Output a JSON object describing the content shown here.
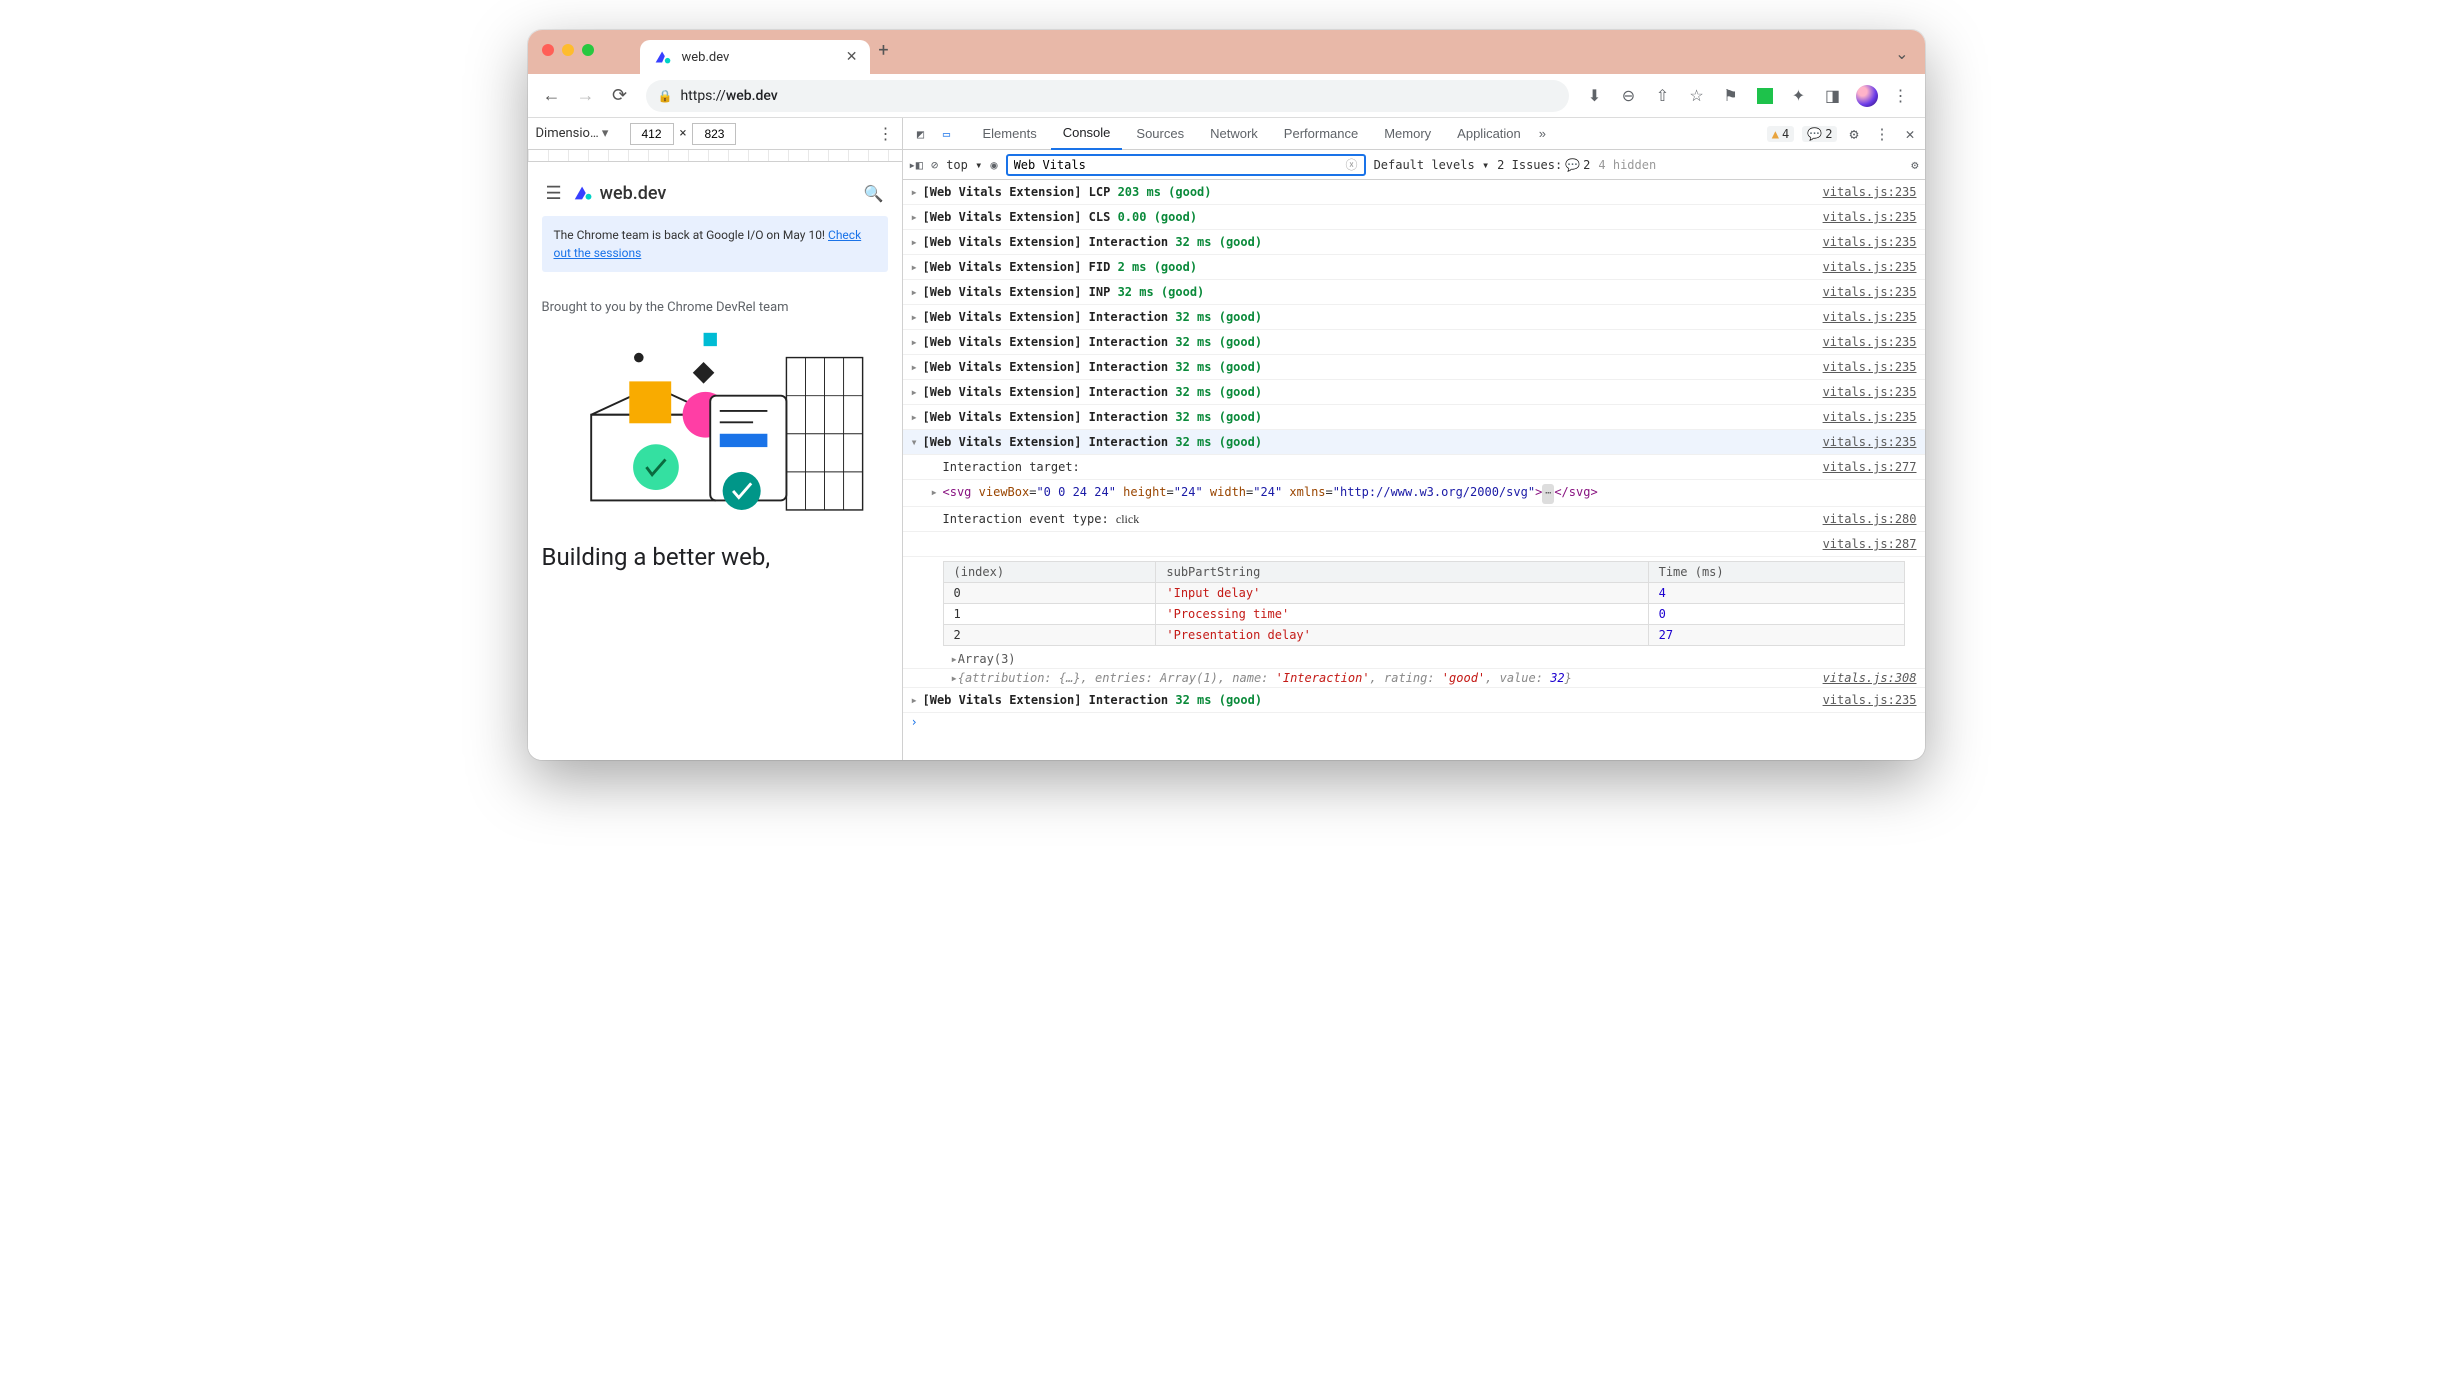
{
  "browser": {
    "tab_title": "web.dev",
    "url_display": "https://web.dev",
    "url_host": "web.dev",
    "traffic": [
      "red",
      "yellow",
      "green"
    ]
  },
  "device": {
    "dimensions_label": "Dimensio…",
    "width": "412",
    "height": "823",
    "times": "×"
  },
  "preview": {
    "brand": "web.dev",
    "banner_text_pre": "The Chrome team is back at Google I/O on May 10! ",
    "banner_link": "Check out the sessions",
    "brought": "Brought to you by the Chrome DevRel team",
    "headline": "Building a better web,"
  },
  "devtools": {
    "tabs": [
      "Elements",
      "Console",
      "Sources",
      "Network",
      "Performance",
      "Memory",
      "Application"
    ],
    "active_tab": "Console",
    "more": "»",
    "warn_count": "4",
    "msg_count": "2",
    "filter_top": "top",
    "filter_value": "Web Vitals",
    "levels": "Default levels",
    "issues_label": "2 Issues:",
    "issues_count": "2",
    "hidden": "4 hidden"
  },
  "console_rows": [
    {
      "prefix": "[Web Vitals Extension]",
      "metric": "LCP",
      "val": "203 ms (good)",
      "src": "vitals.js:235"
    },
    {
      "prefix": "[Web Vitals Extension]",
      "metric": "CLS",
      "val": "0.00 (good)",
      "src": "vitals.js:235"
    },
    {
      "prefix": "[Web Vitals Extension]",
      "metric": "Interaction",
      "val": "32 ms (good)",
      "src": "vitals.js:235"
    },
    {
      "prefix": "[Web Vitals Extension]",
      "metric": "FID",
      "val": "2 ms (good)",
      "src": "vitals.js:235"
    },
    {
      "prefix": "[Web Vitals Extension]",
      "metric": "INP",
      "val": "32 ms (good)",
      "src": "vitals.js:235"
    },
    {
      "prefix": "[Web Vitals Extension]",
      "metric": "Interaction",
      "val": "32 ms (good)",
      "src": "vitals.js:235"
    },
    {
      "prefix": "[Web Vitals Extension]",
      "metric": "Interaction",
      "val": "32 ms (good)",
      "src": "vitals.js:235"
    },
    {
      "prefix": "[Web Vitals Extension]",
      "metric": "Interaction",
      "val": "32 ms (good)",
      "src": "vitals.js:235"
    },
    {
      "prefix": "[Web Vitals Extension]",
      "metric": "Interaction",
      "val": "32 ms (good)",
      "src": "vitals.js:235"
    },
    {
      "prefix": "[Web Vitals Extension]",
      "metric": "Interaction",
      "val": "32 ms (good)",
      "src": "vitals.js:235"
    }
  ],
  "expanded": {
    "prefix": "[Web Vitals Extension]",
    "metric": "Interaction",
    "val": "32 ms (good)",
    "src": "vitals.js:235",
    "target_label": "Interaction target:",
    "target_src": "vitals.js:277",
    "svg_line": "<svg viewBox=\"0 0 24 24\" height=\"24\" width=\"24\" xmlns=\"http://www.w3.org/2000/svg\">…</svg>",
    "event_label": "Interaction event type: ",
    "event_val": "click",
    "event_src": "vitals.js:280",
    "table_src": "vitals.js:287",
    "table_head": [
      "(index)",
      "subPartString",
      "Time (ms)"
    ],
    "table_rows": [
      {
        "i": "0",
        "s": "'Input delay'",
        "t": "4"
      },
      {
        "i": "1",
        "s": "'Processing time'",
        "t": "0"
      },
      {
        "i": "2",
        "s": "'Presentation delay'",
        "t": "27"
      }
    ],
    "array_label": "Array(3)",
    "attribution_line": "{attribution: {…}, entries: Array(1), name: 'Interaction', rating: 'good', value: 32}",
    "attr_src": "vitals.js:308"
  },
  "last_row": {
    "prefix": "[Web Vitals Extension]",
    "metric": "Interaction",
    "val": "32 ms (good)",
    "src": "vitals.js:235"
  }
}
